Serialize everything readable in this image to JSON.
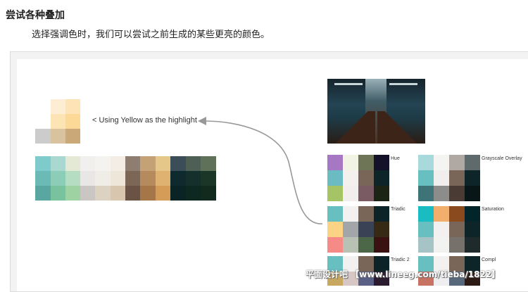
{
  "heading": "尝试各种叠加",
  "description": "选择强调色时，我们可以尝试之前生成的某些更亮的颜色。",
  "highlight_label": "< Using Yellow as the highlight",
  "grid_labels": {
    "hue": "Hue",
    "grayscale_overlay": "Grayscale Overlay",
    "triadic": "Triadic",
    "saturation": "Saturation",
    "triadic_2": "Triadic 2",
    "compl": "Compl"
  },
  "watermark": "平面设计吧 【www.lineeg.com/tieba/1822】",
  "colors": {
    "arrow": "#999999",
    "frame": "#f3f3f3"
  }
}
